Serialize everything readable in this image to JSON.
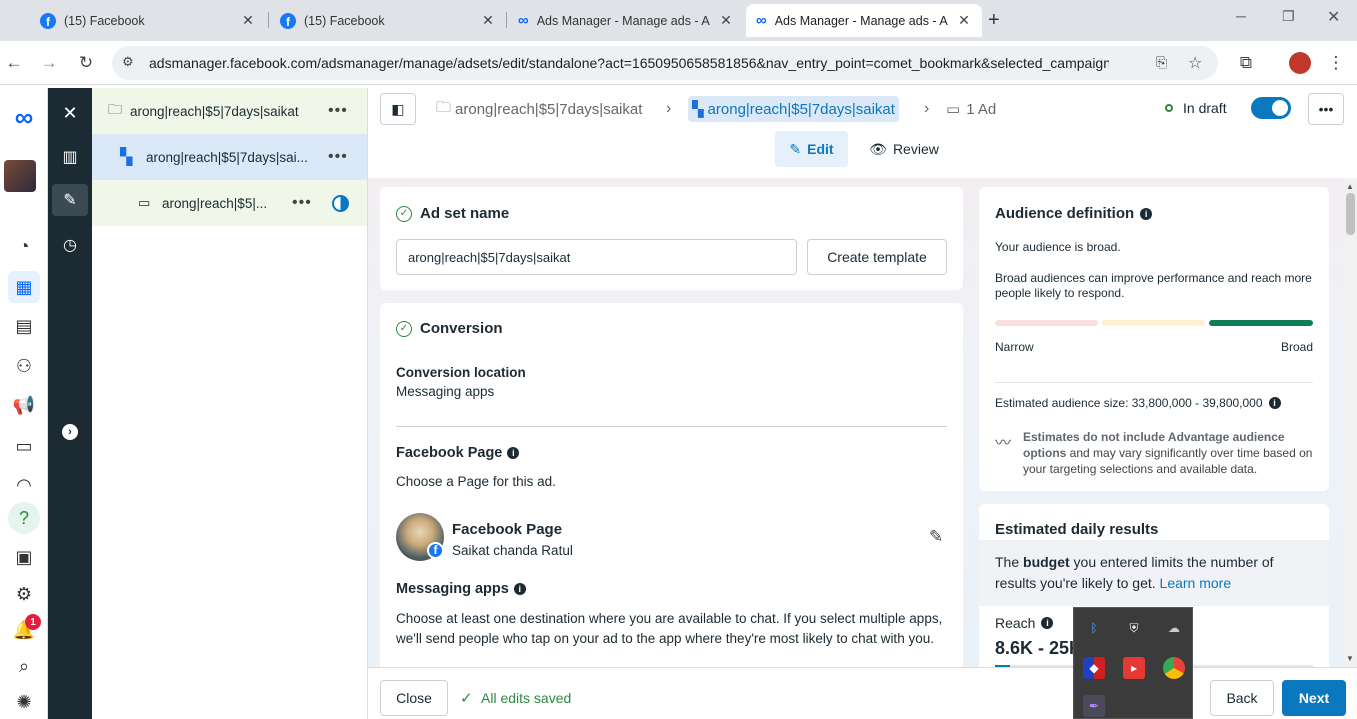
{
  "browser": {
    "tabs": [
      {
        "title": "(15) Facebook"
      },
      {
        "title": "(15) Facebook"
      },
      {
        "title": "Ads Manager - Manage ads - A"
      },
      {
        "title": "Ads Manager - Manage ads - A"
      }
    ],
    "url": "adsmanager.facebook.com/adsmanager/manage/adsets/edit/standalone?act=1650950658581856&nav_entry_point=comet_bookmark&selected_campaign_ids..."
  },
  "sidebar": {
    "notification_count": "1"
  },
  "tree": {
    "campaign": "arong|reach|$5|7days|saikat",
    "adset": "arong|reach|$5|7days|sai...",
    "ad": "arong|reach|$5|..."
  },
  "header": {
    "crumb_campaign": "arong|reach|$5|7days|saikat",
    "crumb_adset": "arong|reach|$5|7days|saikat",
    "crumb_ad": "1 Ad",
    "status": "In draft",
    "edit_label": "Edit",
    "review_label": "Review"
  },
  "adset_name": {
    "title": "Ad set name",
    "value": "arong|reach|$5|7days|saikat",
    "create_template": "Create template"
  },
  "conversion": {
    "title": "Conversion",
    "location_label": "Conversion location",
    "location_value": "Messaging apps",
    "page_title": "Facebook Page",
    "page_desc": "Choose a Page for this ad.",
    "page_name": "Facebook Page",
    "page_owner": "Saikat chanda Ratul",
    "apps_title": "Messaging apps",
    "apps_desc": "Choose at least one destination where you are available to chat. If you select multiple apps, we'll send people who tap on your ad to the app where they're most likely to chat with you."
  },
  "audience": {
    "title": "Audience definition",
    "broad": "Your audience is broad.",
    "desc": "Broad audiences can improve performance and reach more people likely to respond.",
    "narrow": "Narrow",
    "broad_label": "Broad",
    "size": "Estimated audience size: 33,800,000 - 39,800,000",
    "note_bold": "Estimates do not include Advantage audience options",
    "note_rest": " and may vary significantly over time based on your targeting selections and available data."
  },
  "results": {
    "title": "Estimated daily results",
    "budget_pre": "The ",
    "budget_bold": "budget",
    "budget_post": " you entered limits the number of results you're likely to get. ",
    "learn_more": "Learn more",
    "reach_label": "Reach",
    "reach_value": "8.6K - 25K"
  },
  "footer": {
    "close": "Close",
    "saved": "All edits saved",
    "back": "Back",
    "next": "Next"
  },
  "colors": {
    "accent": "#0a78be",
    "brand": "#1877f2",
    "success": "#2b8a3e"
  }
}
